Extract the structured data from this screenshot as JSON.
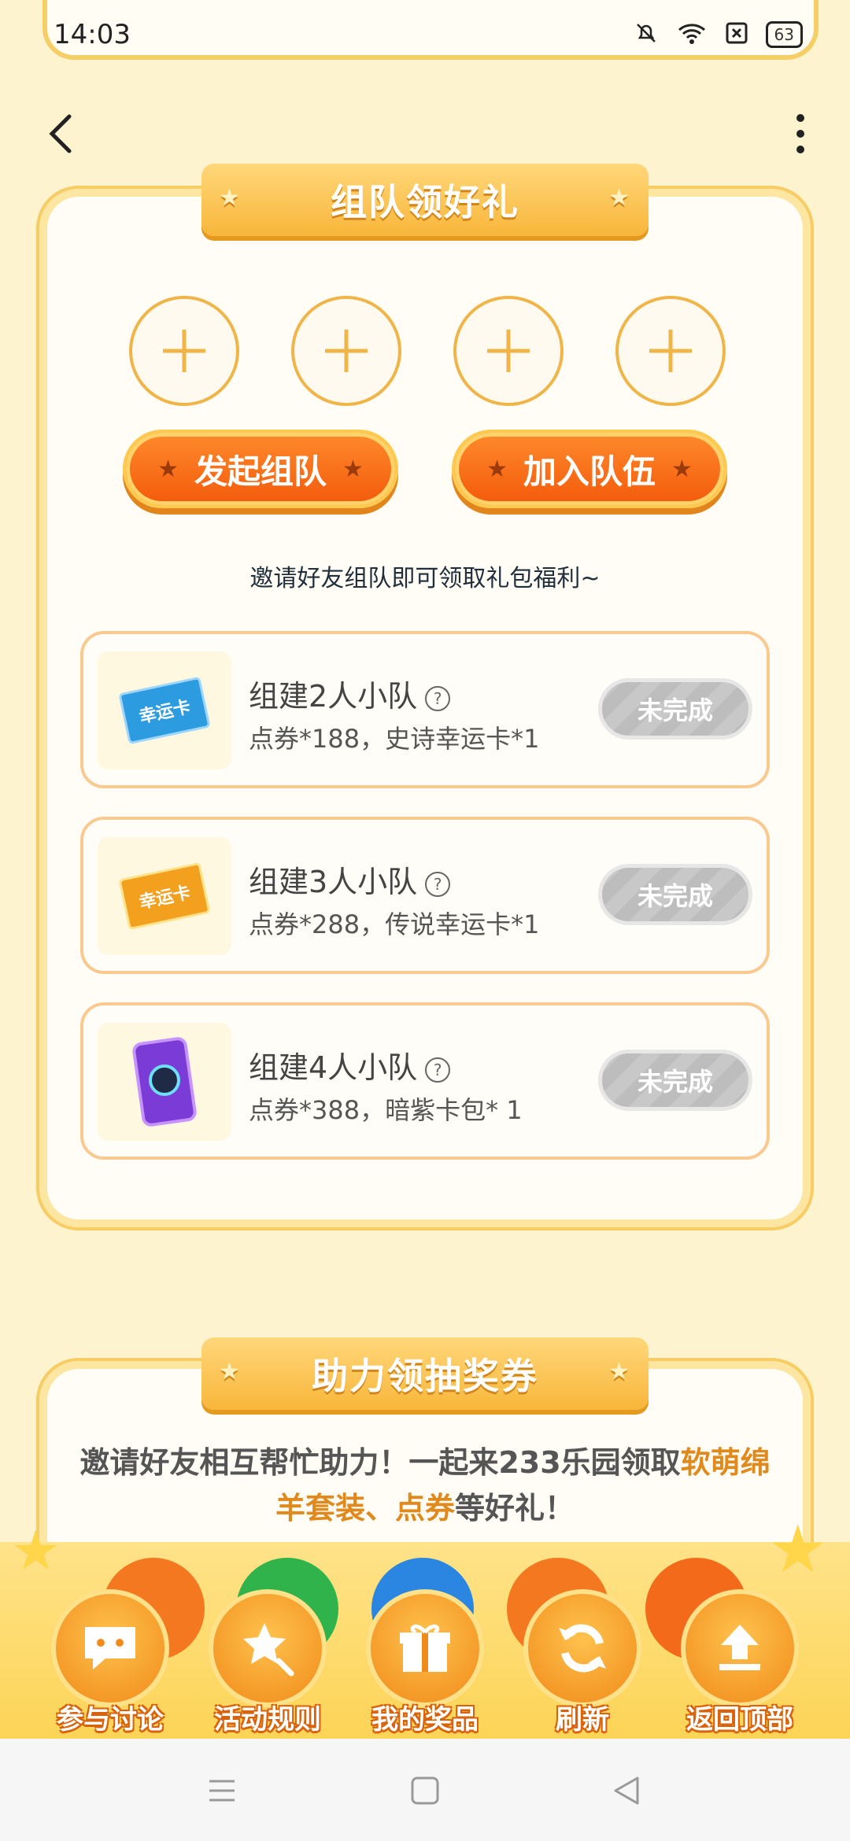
{
  "status_bar": {
    "time": "14:03",
    "battery": "63"
  },
  "team_section": {
    "title": "组队领好礼",
    "start_team_label": "发起组队",
    "join_team_label": "加入队伍",
    "invite_tip": "邀请好友组队即可领取礼包福利~",
    "tasks": [
      {
        "title": "组建2人小队",
        "reward": "点券*188，史诗幸运卡*1",
        "thumb_text": "幸运卡",
        "thumb_icon": "blue-lucky-card-icon",
        "status": "未完成"
      },
      {
        "title": "组建3人小队",
        "reward": "点券*288，传说幸运卡*1",
        "thumb_text": "幸运卡",
        "thumb_icon": "gold-lucky-card-icon",
        "status": "未完成"
      },
      {
        "title": "组建4人小队",
        "reward": "点券*388，暗紫卡包* 1",
        "thumb_text": "",
        "thumb_icon": "purple-card-pack-icon",
        "status": "未完成"
      }
    ]
  },
  "help_section": {
    "title": "助力领抽奖券",
    "desc_part1": "邀请好友相互帮忙助力！一起来233乐园领取",
    "desc_highlight1": "软萌绵羊套装、点券",
    "desc_part2": "等好礼！"
  },
  "dock": {
    "items": [
      {
        "label": "参与讨论",
        "icon": "chat-icon"
      },
      {
        "label": "活动规则",
        "icon": "star-search-icon"
      },
      {
        "label": "我的奖品",
        "icon": "gift-icon"
      },
      {
        "label": "刷新",
        "icon": "refresh-icon"
      },
      {
        "label": "返回顶部",
        "icon": "upload-arrow-icon"
      }
    ]
  },
  "colors": {
    "accent_orange": "#f35a0b",
    "banner_gold": "#f8b63a",
    "background": "#fdf3cf"
  }
}
